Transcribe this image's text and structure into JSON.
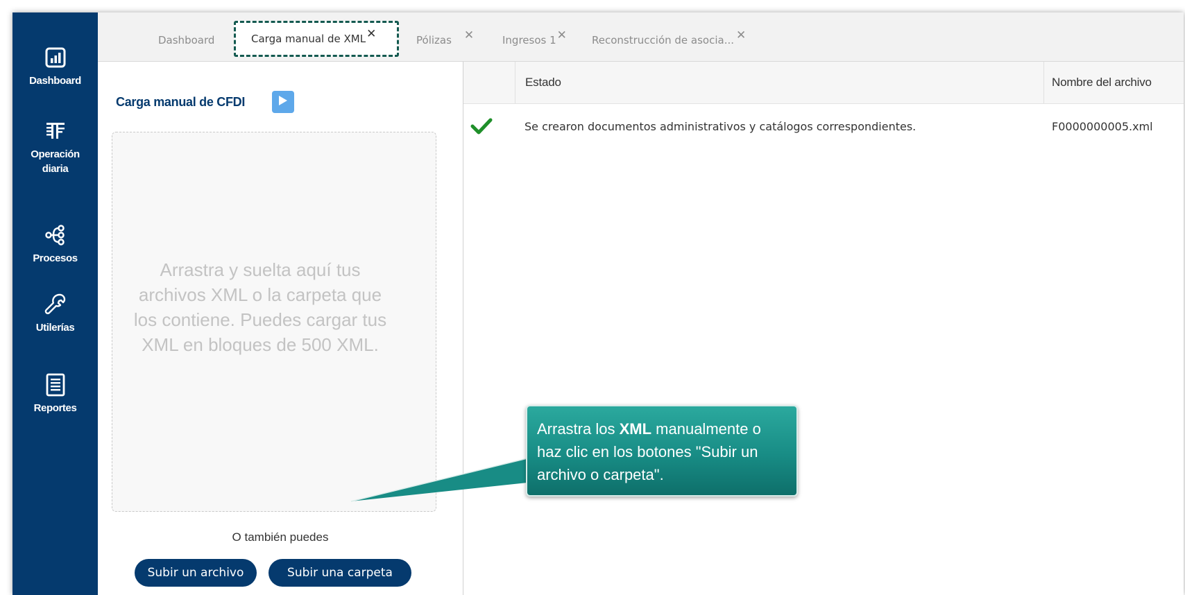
{
  "sidebar": {
    "items": [
      {
        "label": "Dashboard",
        "icon": "bar-chart-icon"
      },
      {
        "label": "Operación diaria",
        "icon": "daily-operation-icon"
      },
      {
        "label": "Procesos",
        "icon": "process-flow-icon"
      },
      {
        "label": "Utilerías",
        "icon": "wrench-icon"
      },
      {
        "label": "Reportes",
        "icon": "report-document-icon"
      }
    ]
  },
  "tabs": [
    {
      "label": "Dashboard",
      "closable": false
    },
    {
      "label": "Carga manual de XML",
      "closable": true,
      "active": true
    },
    {
      "label": "Pólizas",
      "closable": true
    },
    {
      "label": "Ingresos 1",
      "closable": true
    },
    {
      "label": "Reconstrucción de asocia...",
      "closable": true
    }
  ],
  "tab_close_symbol": "✕",
  "left_panel": {
    "title": "Carga manual de CFDI",
    "dropzone_text": "Arrastra y suelta aquí tus archivos XML o la carpeta que los contiene. Puedes cargar tus XML en bloques de 500 XML.",
    "alt_label": "O también puedes",
    "upload_file_label": "Subir un archivo",
    "upload_folder_label": "Subir una carpeta"
  },
  "table": {
    "columns": [
      "Estado",
      "Nombre del archivo"
    ],
    "rows": [
      {
        "status_icon": "check-icon",
        "estado": "Se crearon documentos administrativos y catálogos correspondientes.",
        "archivo": "F0000000005.xml"
      }
    ]
  },
  "callout": {
    "text_before": "Arrastra los ",
    "text_bold": "XML",
    "text_after": " manualmente o haz clic en los botones \"Subir un archivo o carpeta\"."
  },
  "colors": {
    "sidebar": "#053a6e",
    "accent_button": "#053a6e",
    "play_button": "#5ea8ea",
    "check": "#1f8f2a",
    "callout": "#188c85",
    "active_tab_border": "#145a50"
  }
}
